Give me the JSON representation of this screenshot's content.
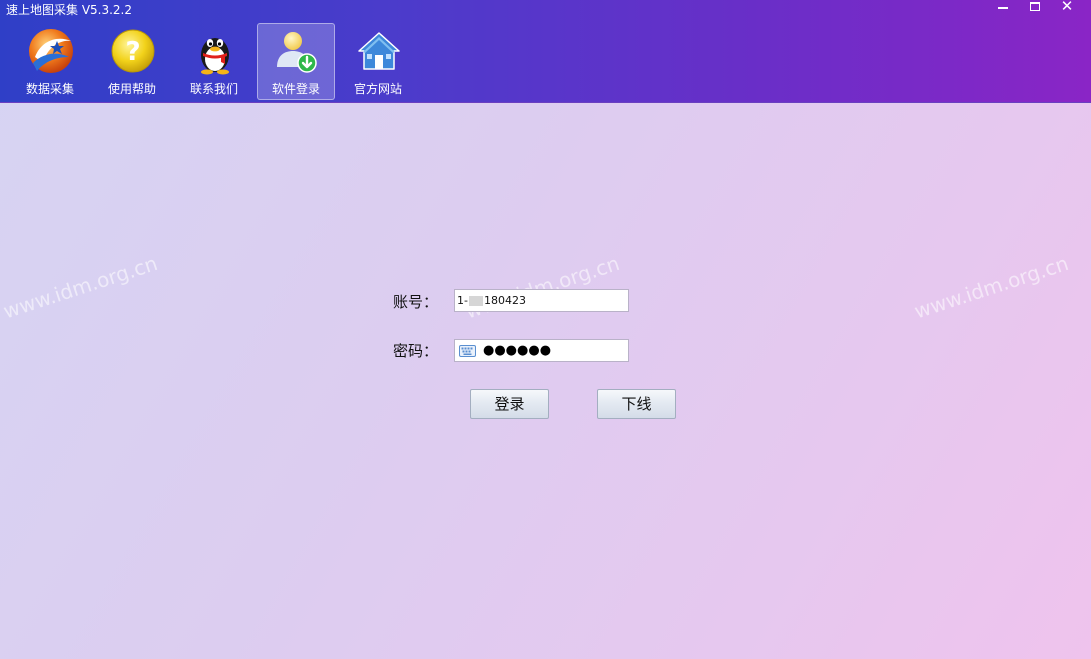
{
  "window": {
    "title": "速上地图采集 V5.3.2.2",
    "minimize_icon": "minimize-icon",
    "maximize_icon": "maximize-icon",
    "close_label": "✕"
  },
  "toolbar": {
    "items": [
      {
        "label": "数据采集",
        "icon": "data-collect-icon",
        "active": false
      },
      {
        "label": "使用帮助",
        "icon": "help-icon",
        "active": false
      },
      {
        "label": "联系我们",
        "icon": "qq-penguin-icon",
        "active": false
      },
      {
        "label": "软件登录",
        "icon": "user-login-icon",
        "active": true
      },
      {
        "label": "官方网站",
        "icon": "home-icon",
        "active": false
      }
    ]
  },
  "watermark": {
    "text": "www.idm.org.cn"
  },
  "login": {
    "account_label": "账号：",
    "account_prefix": "1-",
    "account_suffix": "180423",
    "password_label": "密码：",
    "password_value": "●●●●●●",
    "login_button": "登录",
    "logout_button": "下线"
  },
  "colors": {
    "header_start": "#2f3fc7",
    "header_end": "#8a25c6",
    "body_bg_start": "#d6d4f3",
    "body_bg_end": "#efc3ed"
  }
}
